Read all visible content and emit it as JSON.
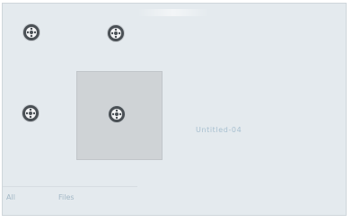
{
  "app": {
    "background_color": "#e4eaee",
    "selected_tile_color": "#cfd3d6",
    "icon_color": "#4a5055"
  },
  "grid": {
    "icons": [
      {
        "icon": "film-reel-icon"
      },
      {
        "icon": "film-reel-icon"
      },
      {
        "icon": "film-reel-icon"
      },
      {
        "icon": "film-reel-icon"
      }
    ],
    "selected_caption": "Untitled-04"
  },
  "footer": {
    "link_left": "All",
    "link_right": "Files"
  }
}
